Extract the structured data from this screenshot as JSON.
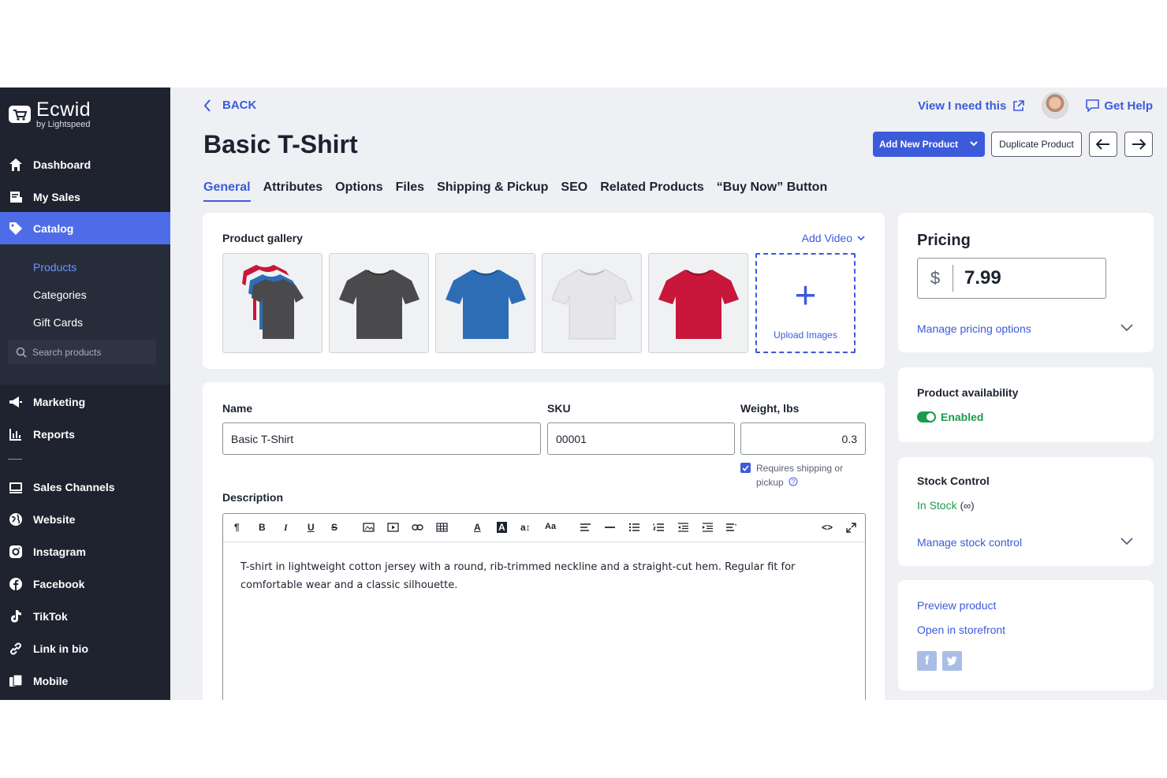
{
  "brand": {
    "name": "Ecwid",
    "sub": "by Lightspeed"
  },
  "sidebar": {
    "items": [
      {
        "label": "Dashboard",
        "icon": "home-icon"
      },
      {
        "label": "My Sales",
        "icon": "sales-icon"
      },
      {
        "label": "Catalog",
        "icon": "tag-icon",
        "active": true
      },
      {
        "label": "Marketing",
        "icon": "megaphone-icon"
      },
      {
        "label": "Reports",
        "icon": "chart-icon"
      },
      {
        "label": "Sales Channels",
        "icon": "channels-icon"
      },
      {
        "label": "Website",
        "icon": "globe-icon"
      },
      {
        "label": "Instagram",
        "icon": "instagram-icon"
      },
      {
        "label": "Facebook",
        "icon": "facebook-icon"
      },
      {
        "label": "TikTok",
        "icon": "tiktok-icon"
      },
      {
        "label": "Link in bio",
        "icon": "link-icon"
      },
      {
        "label": "Mobile",
        "icon": "mobile-icon"
      }
    ],
    "catalog_sub": [
      "Products",
      "Categories",
      "Gift Cards"
    ],
    "search_placeholder": "Search products"
  },
  "header": {
    "back": "BACK",
    "title": "Basic T-Shirt",
    "view_link": "View I need this",
    "help": "Get Help",
    "add_new": "Add New Product",
    "duplicate": "Duplicate Product"
  },
  "tabs": [
    "General",
    "Attributes",
    "Options",
    "Files",
    "Shipping & Pickup",
    "SEO",
    "Related Products",
    "“Buy Now” Button"
  ],
  "gallery": {
    "title": "Product gallery",
    "add_video": "Add Video",
    "upload": "Upload Images",
    "colors": [
      "stack",
      "#4a4a4c",
      "#2d6db5",
      "#e6e6e8",
      "#c8173a"
    ]
  },
  "form": {
    "name_label": "Name",
    "name_value": "Basic T-Shirt",
    "sku_label": "SKU",
    "sku_value": "00001",
    "weight_label": "Weight, lbs",
    "weight_value": "0.3",
    "requires_shipping": "Requires shipping or pickup",
    "desc_label": "Description",
    "desc_text": "T-shirt in lightweight cotton jersey with a round, rib-trimmed neckline and a straight-cut hem. Regular fit for comfortable wear and a classic silhouette."
  },
  "pricing": {
    "title": "Pricing",
    "currency": "$",
    "price": "7.99",
    "manage": "Manage pricing options"
  },
  "availability": {
    "title": "Product availability",
    "status": "Enabled"
  },
  "stock": {
    "title": "Stock Control",
    "status": "In Stock",
    "infinite": "(∞)",
    "manage": "Manage stock control"
  },
  "preview": {
    "preview": "Preview product",
    "storefront": "Open in storefront"
  },
  "colors": {
    "accent": "#3b5bdb",
    "sidebar": "#1f2330",
    "active": "#4f6ce8",
    "success": "#1c9b4c"
  }
}
